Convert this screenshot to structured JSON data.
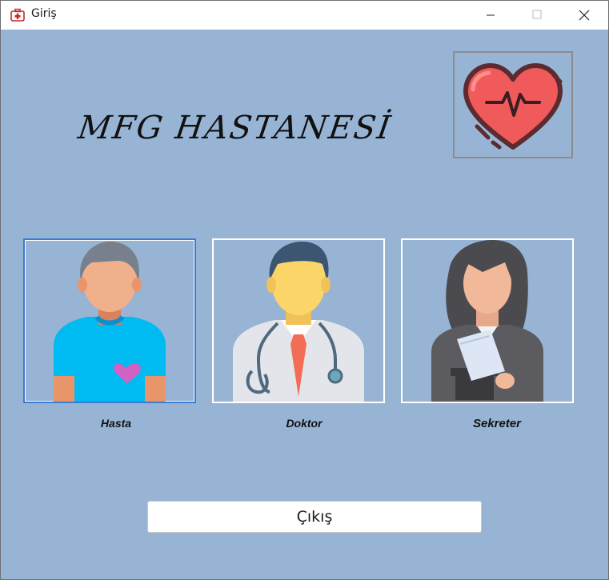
{
  "window": {
    "title": "Giriş"
  },
  "titlebar": {
    "minimize_icon": "minimize-icon",
    "maximize_icon": "maximize-icon",
    "close_icon": "close-icon"
  },
  "header": {
    "hospital_name": "MFG HASTANESİ",
    "logo_icon": "heart-pulse-icon"
  },
  "roles": [
    {
      "label": "Hasta",
      "icon": "patient-avatar-icon"
    },
    {
      "label": "Doktor",
      "icon": "doctor-avatar-icon"
    },
    {
      "label": "Sekreter",
      "icon": "secretary-avatar-icon"
    }
  ],
  "footer": {
    "exit_label": "Çıkış"
  },
  "colors": {
    "background": "#98b4d4",
    "card_border": "#ffffff",
    "focus_border": "#3b7bd0",
    "heart": "#f05a5b"
  }
}
